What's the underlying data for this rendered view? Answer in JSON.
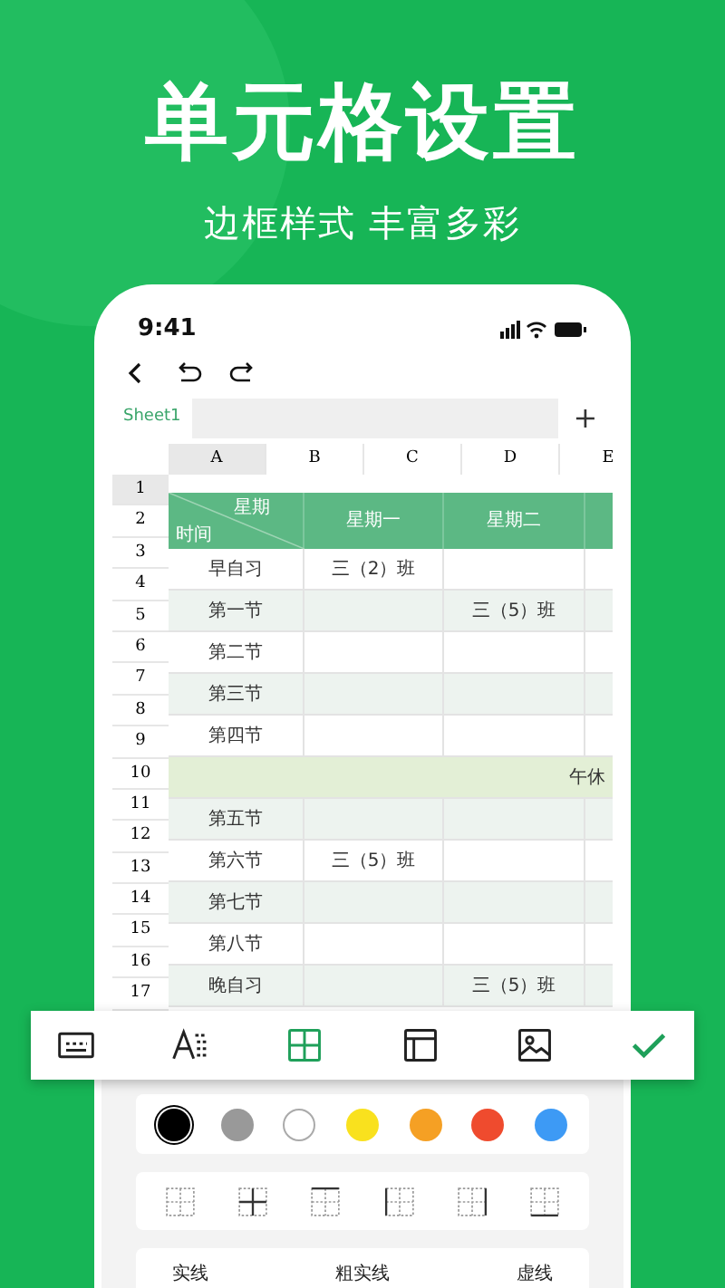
{
  "headline": "单元格设置",
  "subheadline": "边框样式 丰富多彩",
  "phone": {
    "status_time": "9:41",
    "sheet_tab": "Sheet1",
    "add_sheet": "+"
  },
  "column_headers": [
    {
      "label": "A",
      "selected": true
    },
    {
      "label": "B",
      "selected": false
    },
    {
      "label": "C",
      "selected": false
    },
    {
      "label": "D",
      "selected": false
    },
    {
      "label": "E",
      "selected": false
    }
  ],
  "row_numbers": [
    {
      "label": "1",
      "selected": true
    },
    {
      "label": "2",
      "selected": false
    },
    {
      "label": "3",
      "selected": false
    },
    {
      "label": "4",
      "selected": false
    },
    {
      "label": "5",
      "selected": false
    },
    {
      "label": "6",
      "selected": false
    },
    {
      "label": "7",
      "selected": false
    },
    {
      "label": "8",
      "selected": false
    },
    {
      "label": "9",
      "selected": false
    },
    {
      "label": "10",
      "selected": false
    },
    {
      "label": "11",
      "selected": false
    },
    {
      "label": "12",
      "selected": false
    },
    {
      "label": "13",
      "selected": false
    },
    {
      "label": "14",
      "selected": false
    },
    {
      "label": "15",
      "selected": false
    },
    {
      "label": "16",
      "selected": false
    },
    {
      "label": "17",
      "selected": false
    }
  ],
  "table": {
    "header": [
      {
        "kind": "diagonal",
        "top": "星期",
        "bottom": "时间"
      },
      {
        "kind": "text",
        "label": "星期一"
      },
      {
        "kind": "text",
        "label": "星期二"
      }
    ],
    "rows": [
      {
        "kind": "lesson",
        "shaded": false,
        "cells": [
          "早自习",
          "三（2）班",
          ""
        ]
      },
      {
        "kind": "lesson",
        "shaded": true,
        "cells": [
          "第一节",
          "",
          "三（5）班"
        ]
      },
      {
        "kind": "lesson",
        "shaded": false,
        "cells": [
          "第二节",
          "",
          ""
        ]
      },
      {
        "kind": "lesson",
        "shaded": true,
        "cells": [
          "第三节",
          "",
          ""
        ]
      },
      {
        "kind": "lesson",
        "shaded": false,
        "cells": [
          "第四节",
          "",
          ""
        ]
      },
      {
        "kind": "break",
        "cells": [
          "午休"
        ]
      },
      {
        "kind": "lesson",
        "shaded": true,
        "cells": [
          "第五节",
          "",
          ""
        ]
      },
      {
        "kind": "lesson",
        "shaded": false,
        "cells": [
          "第六节",
          "三（5）班",
          ""
        ]
      },
      {
        "kind": "lesson",
        "shaded": true,
        "cells": [
          "第七节",
          "",
          ""
        ]
      },
      {
        "kind": "lesson",
        "shaded": false,
        "cells": [
          "第八节",
          "",
          ""
        ]
      },
      {
        "kind": "lesson",
        "shaded": true,
        "cells": [
          "晚自习",
          "",
          "三（5）班"
        ]
      }
    ]
  },
  "toolbar": [
    {
      "kind": "cell",
      "selected": false
    },
    {
      "kind": "font",
      "selected": false
    },
    {
      "kind": "border",
      "selected": true
    },
    {
      "kind": "layout",
      "selected": false
    },
    {
      "kind": "image",
      "selected": false
    }
  ],
  "colors": [
    {
      "color": "#000000",
      "selected": true
    },
    {
      "color": "#999999",
      "selected": false
    },
    {
      "color": "#ffffff",
      "selected": false
    },
    {
      "color": "#f9e11e",
      "selected": false
    },
    {
      "color": "#f5a024",
      "selected": false
    },
    {
      "color": "#ef4b2e",
      "selected": false
    },
    {
      "color": "#3d9af5",
      "selected": false
    }
  ],
  "border_options": [
    {
      "kind": "none"
    },
    {
      "kind": "inner"
    },
    {
      "kind": "top"
    },
    {
      "kind": "left"
    },
    {
      "kind": "right"
    },
    {
      "kind": "bottom"
    }
  ],
  "line_styles": [
    "实线",
    "粗实线",
    "虚线"
  ]
}
